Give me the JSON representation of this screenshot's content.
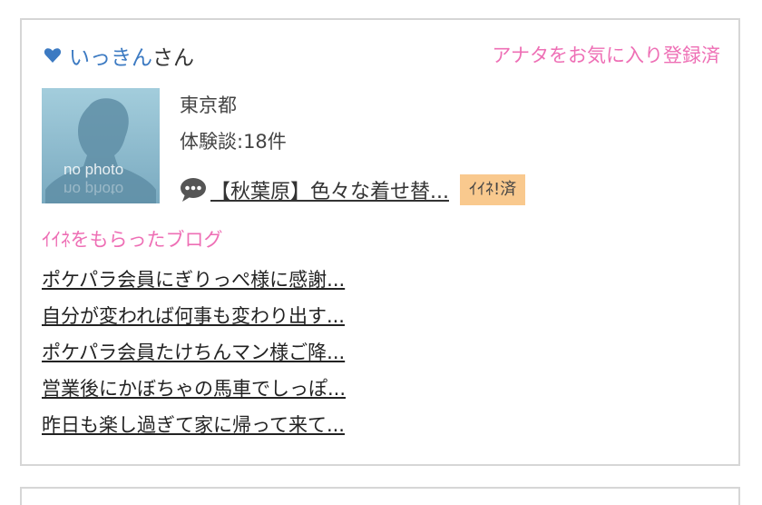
{
  "user": {
    "name": "いっきん",
    "suffix": "さん",
    "favorite_status": "アナタをお気に入り登録済"
  },
  "avatar": {
    "placeholder_text": "no photo"
  },
  "profile": {
    "prefecture": "東京都",
    "review_count": "体験談:18件"
  },
  "review": {
    "title": "【秋葉原】色々な着せ替...",
    "like_status": "ｲｲﾈ!済"
  },
  "blogs": {
    "heading": "ｲｲﾈをもらったブログ",
    "items": [
      "ポケパラ会員にぎりっぺ様に感謝...",
      "自分が変われば何事も変わり出す...",
      "ポケパラ会員たけちんマン様ご降...",
      "営業後にかぼちゃの馬車でしっぽ...",
      "昨日も楽し過ぎて家に帰って来て..."
    ]
  },
  "colors": {
    "link_blue": "#3c7ac2",
    "pink": "#ee6fb5",
    "badge_bg": "#f9c98e",
    "border": "#d6d6d6"
  },
  "icons": [
    "heart-icon",
    "speech-bubble-icon"
  ]
}
